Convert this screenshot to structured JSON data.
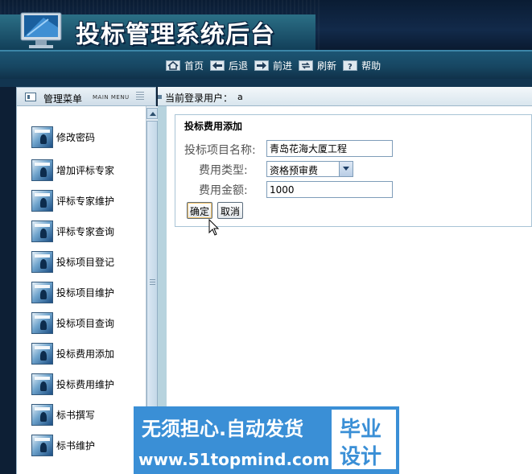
{
  "header": {
    "app_title": "投标管理系统后台"
  },
  "nav": {
    "items": [
      {
        "label": "首页",
        "icon": "home-icon"
      },
      {
        "label": "后退",
        "icon": "arrow-left-icon"
      },
      {
        "label": "前进",
        "icon": "arrow-right-icon"
      },
      {
        "label": "刷新",
        "icon": "refresh-icon"
      },
      {
        "label": "帮助",
        "icon": "help-icon"
      }
    ]
  },
  "menu": {
    "title": "管理菜单",
    "subtitle": "MAIN MENU",
    "items": [
      {
        "label": "修改密码"
      },
      {
        "label": "增加评标专家"
      },
      {
        "label": "评标专家维护"
      },
      {
        "label": "评标专家查询"
      },
      {
        "label": "投标项目登记"
      },
      {
        "label": "投标项目维护"
      },
      {
        "label": "投标项目查询"
      },
      {
        "label": "投标费用添加"
      },
      {
        "label": "投标费用维护"
      },
      {
        "label": "标书撰写"
      },
      {
        "label": "标书维护"
      }
    ]
  },
  "user": {
    "label": "当前登录用户：",
    "name": "a"
  },
  "form": {
    "title": "投标费用添加",
    "project_name_label": "投标项目名称:",
    "project_name_value": "青岛花海大厦工程",
    "fee_type_label": "费用类型:",
    "fee_type_value": "资格预审费",
    "amount_label": "费用金额:",
    "amount_value": "1000",
    "confirm_label": "确定",
    "cancel_label": "取消"
  },
  "watermark": {
    "line1": "无须担心.自动发货",
    "line2": "www.51topmind.com",
    "box_line1": "毕业",
    "box_line2": "设计"
  }
}
